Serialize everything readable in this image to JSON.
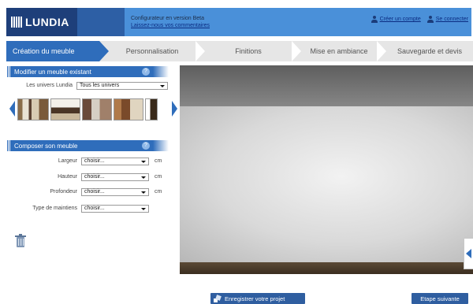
{
  "header": {
    "logo_text": "LUNDIA",
    "config_title": "Configurateur en version Beta",
    "config_link": "Laissez-nous vos commentaires",
    "create_account": "Créer un compte",
    "login": "Se connecter"
  },
  "steps": [
    {
      "label": "Création du meuble",
      "active": true
    },
    {
      "label": "Personnalisation",
      "active": false
    },
    {
      "label": "Finitions",
      "active": false
    },
    {
      "label": "Mise en ambiance",
      "active": false
    },
    {
      "label": "Sauvegarde et devis",
      "active": false
    }
  ],
  "modify_panel": {
    "title": "Modifier un meuble existant",
    "universe_label": "Les univers Lundia",
    "universe_value": "Tous les univers"
  },
  "compose_panel": {
    "title": "Composer son meuble",
    "fields": [
      {
        "label": "Largeur",
        "value": "choisir...",
        "unit": "cm"
      },
      {
        "label": "Hauteur",
        "value": "choisir...",
        "unit": "cm"
      },
      {
        "label": "Profondeur",
        "value": "choisir...",
        "unit": "cm"
      },
      {
        "label": "Type de maintiens",
        "value": "choisir...",
        "unit": ""
      }
    ]
  },
  "footer": {
    "save_label": "Enregistrer votre projet",
    "next_label": "Etape suivante"
  },
  "colors": {
    "header_bg": "#4a90d9",
    "logo_bg": "#1e3f7a",
    "accent": "#2f6dbb",
    "button_bg": "#2f5ea0"
  },
  "icons": [
    "user-icon",
    "help-icon",
    "trash-icon",
    "save-icon",
    "caret-down-icon",
    "arrow-left-icon",
    "arrow-right-icon"
  ]
}
